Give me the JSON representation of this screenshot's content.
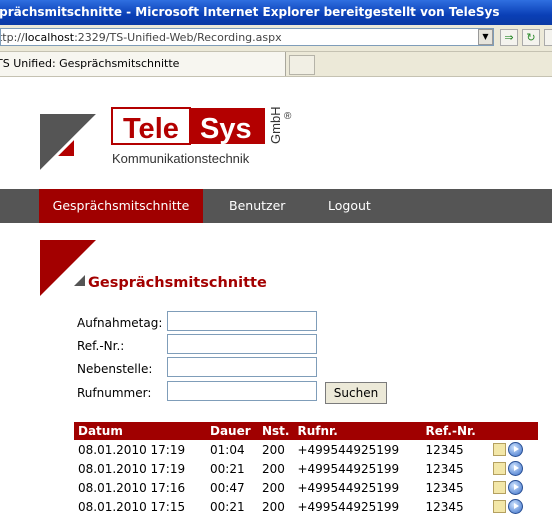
{
  "window": {
    "title": "Gesprächsmitschnitte - Microsoft Internet Explorer bereitgestellt von TeleSys"
  },
  "address": {
    "prefix": "http://",
    "host": "localhost",
    "path": ":2329/TS-Unified-Web/Recording.aspx"
  },
  "tab": {
    "label": "TS Unified: Gesprächsmitschnitte"
  },
  "logo": {
    "part1": "Tele",
    "part2": "Sys",
    "gmbh": "GmbH",
    "reg": "®",
    "tagline": "Kommunikationstechnik"
  },
  "nav": {
    "items": [
      "Gesprächsmitschnitte",
      "Benutzer",
      "Logout"
    ],
    "active": "Gesprächsmitschnitte"
  },
  "page": {
    "title": "Gesprächsmitschnitte"
  },
  "form": {
    "aufnahmetag_label": "Aufnahmetag:",
    "refnr_label": "Ref.-Nr.:",
    "nebenstelle_label": "Nebenstelle:",
    "rufnummer_label": "Rufnummer:",
    "search_button": "Suchen"
  },
  "table": {
    "headers": [
      "Datum",
      "Dauer",
      "Nst.",
      "Rufnr.",
      "Ref.-Nr."
    ],
    "rows": [
      [
        "08.01.2010 17:19",
        "01:04",
        "200",
        "+499544925199",
        "12345"
      ],
      [
        "08.01.2010 17:19",
        "00:21",
        "200",
        "+499544925199",
        "12345"
      ],
      [
        "08.01.2010 17:16",
        "00:47",
        "200",
        "+499544925199",
        "12345"
      ],
      [
        "08.01.2010 17:15",
        "00:21",
        "200",
        "+499544925199",
        "12345"
      ]
    ]
  },
  "colors": {
    "brand_red": "#a00000",
    "nav_bg": "#555555",
    "title_blue": "#0a3fb6"
  },
  "icons": {
    "row_actions": [
      "note-icon",
      "play-icon"
    ]
  }
}
